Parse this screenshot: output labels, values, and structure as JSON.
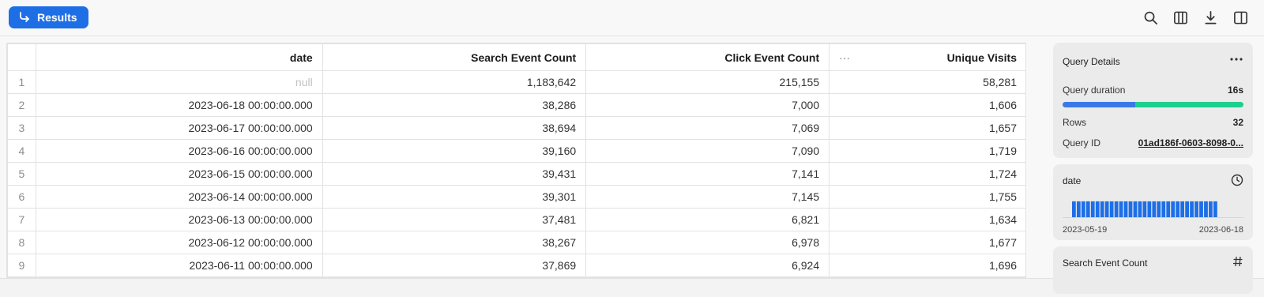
{
  "toolbar": {
    "results_label": "Results",
    "icons": [
      "search-icon",
      "columns-icon",
      "download-icon",
      "split-panel-icon"
    ]
  },
  "table": {
    "columns": [
      "date",
      "Search Event Count",
      "Click Event Count",
      "Unique Visits"
    ],
    "rows": [
      {
        "n": "1",
        "date": "null",
        "search": "1,183,642",
        "click": "215,155",
        "visits": "58,281"
      },
      {
        "n": "2",
        "date": "2023-06-18 00:00:00.000",
        "search": "38,286",
        "click": "7,000",
        "visits": "1,606"
      },
      {
        "n": "3",
        "date": "2023-06-17 00:00:00.000",
        "search": "38,694",
        "click": "7,069",
        "visits": "1,657"
      },
      {
        "n": "4",
        "date": "2023-06-16 00:00:00.000",
        "search": "39,160",
        "click": "7,090",
        "visits": "1,719"
      },
      {
        "n": "5",
        "date": "2023-06-15 00:00:00.000",
        "search": "39,431",
        "click": "7,141",
        "visits": "1,724"
      },
      {
        "n": "6",
        "date": "2023-06-14 00:00:00.000",
        "search": "39,301",
        "click": "7,145",
        "visits": "1,755"
      },
      {
        "n": "7",
        "date": "2023-06-13 00:00:00.000",
        "search": "37,481",
        "click": "6,821",
        "visits": "1,634"
      },
      {
        "n": "8",
        "date": "2023-06-12 00:00:00.000",
        "search": "38,267",
        "click": "6,978",
        "visits": "1,677"
      },
      {
        "n": "9",
        "date": "2023-06-11 00:00:00.000",
        "search": "37,869",
        "click": "6,924",
        "visits": "1,696"
      },
      {
        "n": "",
        "date": "",
        "search": "",
        "click": "",
        "visits": ""
      }
    ],
    "dots": "···"
  },
  "query_details": {
    "title": "Query Details",
    "duration_label": "Query duration",
    "duration_value": "16s",
    "duration_split_fraction": 0.4,
    "rows_label": "Rows",
    "rows_value": "32",
    "query_id_label": "Query ID",
    "query_id_value": "01ad186f-0603-8098-0..."
  },
  "date_card": {
    "title": "date",
    "start": "2023-05-19",
    "end": "2023-06-18",
    "bar_count": 31
  },
  "search_card": {
    "title": "Search Event Count"
  },
  "colors": {
    "accent": "#1e6fe6",
    "duration_primary": "#3b78e7",
    "duration_secondary": "#1ecf8f"
  }
}
